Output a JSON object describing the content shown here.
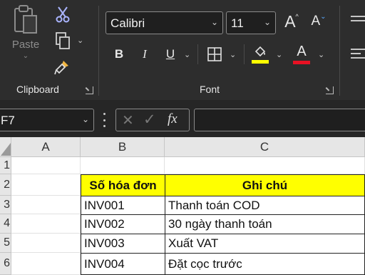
{
  "ribbon": {
    "clipboard": {
      "paste_label": "Paste",
      "group_label": "Clipboard"
    },
    "font": {
      "font_name": "Calibri",
      "font_size": "11",
      "grow_label": "A",
      "shrink_label": "A",
      "bold_label": "B",
      "italic_label": "I",
      "underline_label": "U",
      "font_color_label": "A",
      "group_label": "Font",
      "highlight_color": "#ffff00",
      "font_color": "#e81123"
    }
  },
  "formula_bar": {
    "name_box": "F7",
    "fx_label": "fx",
    "content": ""
  },
  "sheet": {
    "columns": [
      "A",
      "B",
      "C"
    ],
    "rows": [
      {
        "num": "1",
        "b": "",
        "c": ""
      },
      {
        "num": "2",
        "b": "Số hóa đơn",
        "c": "Ghi chú"
      },
      {
        "num": "3",
        "b": "INV001",
        "c": "Thanh toán COD"
      },
      {
        "num": "4",
        "b": "INV002",
        "c": "30 ngày thanh toán"
      },
      {
        "num": "5",
        "b": "INV003",
        "c": "Xuất VAT"
      },
      {
        "num": "6",
        "b": "INV004",
        "c": "Đặt cọc trước"
      }
    ]
  }
}
